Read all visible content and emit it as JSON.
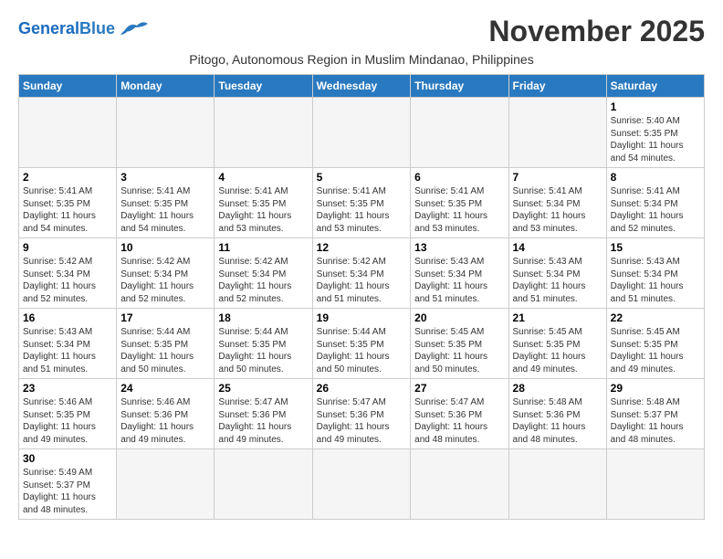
{
  "header": {
    "logo_general": "General",
    "logo_blue": "Blue",
    "month_title": "November 2025",
    "subtitle": "Pitogo, Autonomous Region in Muslim Mindanao, Philippines"
  },
  "weekdays": [
    "Sunday",
    "Monday",
    "Tuesday",
    "Wednesday",
    "Thursday",
    "Friday",
    "Saturday"
  ],
  "weeks": [
    [
      {
        "day": "",
        "info": ""
      },
      {
        "day": "",
        "info": ""
      },
      {
        "day": "",
        "info": ""
      },
      {
        "day": "",
        "info": ""
      },
      {
        "day": "",
        "info": ""
      },
      {
        "day": "",
        "info": ""
      },
      {
        "day": "1",
        "info": "Sunrise: 5:40 AM\nSunset: 5:35 PM\nDaylight: 11 hours and 54 minutes."
      }
    ],
    [
      {
        "day": "2",
        "info": "Sunrise: 5:41 AM\nSunset: 5:35 PM\nDaylight: 11 hours and 54 minutes."
      },
      {
        "day": "3",
        "info": "Sunrise: 5:41 AM\nSunset: 5:35 PM\nDaylight: 11 hours and 54 minutes."
      },
      {
        "day": "4",
        "info": "Sunrise: 5:41 AM\nSunset: 5:35 PM\nDaylight: 11 hours and 53 minutes."
      },
      {
        "day": "5",
        "info": "Sunrise: 5:41 AM\nSunset: 5:35 PM\nDaylight: 11 hours and 53 minutes."
      },
      {
        "day": "6",
        "info": "Sunrise: 5:41 AM\nSunset: 5:35 PM\nDaylight: 11 hours and 53 minutes."
      },
      {
        "day": "7",
        "info": "Sunrise: 5:41 AM\nSunset: 5:34 PM\nDaylight: 11 hours and 53 minutes."
      },
      {
        "day": "8",
        "info": "Sunrise: 5:41 AM\nSunset: 5:34 PM\nDaylight: 11 hours and 52 minutes."
      }
    ],
    [
      {
        "day": "9",
        "info": "Sunrise: 5:42 AM\nSunset: 5:34 PM\nDaylight: 11 hours and 52 minutes."
      },
      {
        "day": "10",
        "info": "Sunrise: 5:42 AM\nSunset: 5:34 PM\nDaylight: 11 hours and 52 minutes."
      },
      {
        "day": "11",
        "info": "Sunrise: 5:42 AM\nSunset: 5:34 PM\nDaylight: 11 hours and 52 minutes."
      },
      {
        "day": "12",
        "info": "Sunrise: 5:42 AM\nSunset: 5:34 PM\nDaylight: 11 hours and 51 minutes."
      },
      {
        "day": "13",
        "info": "Sunrise: 5:43 AM\nSunset: 5:34 PM\nDaylight: 11 hours and 51 minutes."
      },
      {
        "day": "14",
        "info": "Sunrise: 5:43 AM\nSunset: 5:34 PM\nDaylight: 11 hours and 51 minutes."
      },
      {
        "day": "15",
        "info": "Sunrise: 5:43 AM\nSunset: 5:34 PM\nDaylight: 11 hours and 51 minutes."
      }
    ],
    [
      {
        "day": "16",
        "info": "Sunrise: 5:43 AM\nSunset: 5:34 PM\nDaylight: 11 hours and 51 minutes."
      },
      {
        "day": "17",
        "info": "Sunrise: 5:44 AM\nSunset: 5:35 PM\nDaylight: 11 hours and 50 minutes."
      },
      {
        "day": "18",
        "info": "Sunrise: 5:44 AM\nSunset: 5:35 PM\nDaylight: 11 hours and 50 minutes."
      },
      {
        "day": "19",
        "info": "Sunrise: 5:44 AM\nSunset: 5:35 PM\nDaylight: 11 hours and 50 minutes."
      },
      {
        "day": "20",
        "info": "Sunrise: 5:45 AM\nSunset: 5:35 PM\nDaylight: 11 hours and 50 minutes."
      },
      {
        "day": "21",
        "info": "Sunrise: 5:45 AM\nSunset: 5:35 PM\nDaylight: 11 hours and 49 minutes."
      },
      {
        "day": "22",
        "info": "Sunrise: 5:45 AM\nSunset: 5:35 PM\nDaylight: 11 hours and 49 minutes."
      }
    ],
    [
      {
        "day": "23",
        "info": "Sunrise: 5:46 AM\nSunset: 5:35 PM\nDaylight: 11 hours and 49 minutes."
      },
      {
        "day": "24",
        "info": "Sunrise: 5:46 AM\nSunset: 5:36 PM\nDaylight: 11 hours and 49 minutes."
      },
      {
        "day": "25",
        "info": "Sunrise: 5:47 AM\nSunset: 5:36 PM\nDaylight: 11 hours and 49 minutes."
      },
      {
        "day": "26",
        "info": "Sunrise: 5:47 AM\nSunset: 5:36 PM\nDaylight: 11 hours and 49 minutes."
      },
      {
        "day": "27",
        "info": "Sunrise: 5:47 AM\nSunset: 5:36 PM\nDaylight: 11 hours and 48 minutes."
      },
      {
        "day": "28",
        "info": "Sunrise: 5:48 AM\nSunset: 5:36 PM\nDaylight: 11 hours and 48 minutes."
      },
      {
        "day": "29",
        "info": "Sunrise: 5:48 AM\nSunset: 5:37 PM\nDaylight: 11 hours and 48 minutes."
      }
    ],
    [
      {
        "day": "30",
        "info": "Sunrise: 5:49 AM\nSunset: 5:37 PM\nDaylight: 11 hours and 48 minutes."
      },
      {
        "day": "",
        "info": ""
      },
      {
        "day": "",
        "info": ""
      },
      {
        "day": "",
        "info": ""
      },
      {
        "day": "",
        "info": ""
      },
      {
        "day": "",
        "info": ""
      },
      {
        "day": "",
        "info": ""
      }
    ]
  ]
}
